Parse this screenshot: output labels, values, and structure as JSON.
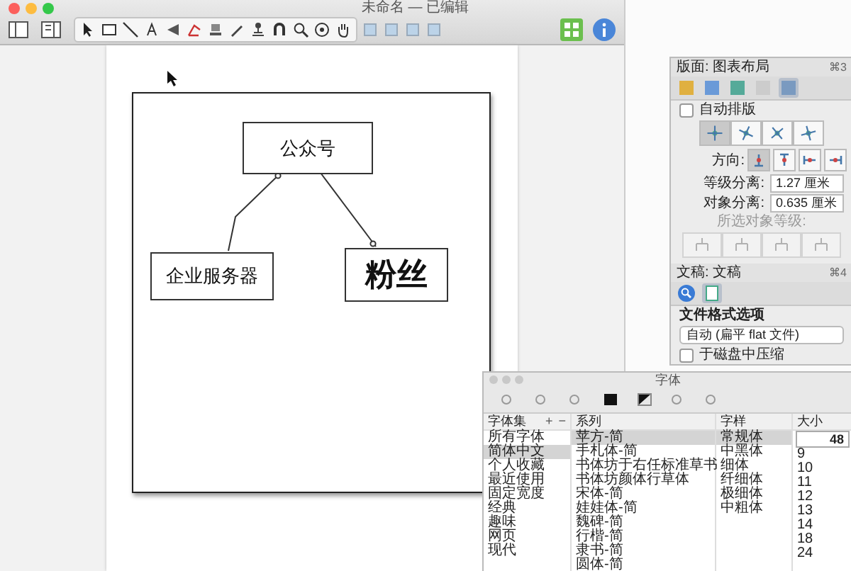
{
  "window": {
    "title": "未命名 — 已编辑"
  },
  "diagram": {
    "nodes": [
      {
        "label": "公众号",
        "kind": "normal"
      },
      {
        "label": "企业服务器",
        "kind": "normal"
      },
      {
        "label": "粉丝",
        "kind": "large"
      }
    ]
  },
  "inspector": {
    "layout": {
      "title": "版面: 图表布局",
      "shortcut": "⌘3",
      "auto_layout": {
        "label": "自动排版",
        "checked": false
      },
      "layout_types": [
        {
          "selected": true
        },
        {
          "selected": false
        },
        {
          "selected": false
        },
        {
          "selected": false
        }
      ],
      "direction_label": "方向:",
      "directions": [
        {
          "selected": true
        },
        {
          "selected": false
        },
        {
          "selected": false
        },
        {
          "selected": false
        }
      ],
      "rank_separation": {
        "label": "等级分离:",
        "value": "1.27 厘米"
      },
      "object_separation": {
        "label": "对象分离:",
        "value": "0.635 厘米"
      },
      "selected_rank_label": "所选对象等级:"
    },
    "document": {
      "title": "文稿: 文稿",
      "shortcut": "⌘4",
      "tabs": [
        {
          "selected": false
        },
        {
          "selected": true
        }
      ],
      "section_title": "文件格式选项",
      "format": "自动 (扁平 flat 文件)",
      "compress": {
        "label": "于磁盘中压缩",
        "checked": false
      }
    }
  },
  "font_panel": {
    "title": "字体",
    "headers": {
      "collections": "字体集",
      "add": "+",
      "remove": "−",
      "family": "系列",
      "typeface": "字样",
      "size": "大小"
    },
    "size_value": "48",
    "collections": [
      {
        "label": "所有字体",
        "selected": false
      },
      {
        "label": "简体中文",
        "selected": true
      },
      {
        "label": "个人收藏",
        "selected": false
      },
      {
        "label": "最近使用",
        "selected": false
      },
      {
        "label": "固定宽度",
        "selected": false
      },
      {
        "label": "经典",
        "selected": false
      },
      {
        "label": "趣味",
        "selected": false
      },
      {
        "label": "网页",
        "selected": false
      },
      {
        "label": "现代",
        "selected": false
      }
    ],
    "families": [
      {
        "label": "苹方-简",
        "selected": true
      },
      {
        "label": "手札体-简",
        "selected": false
      },
      {
        "label": "书体坊于右任标准草书",
        "selected": false
      },
      {
        "label": "书体坊颜体行草体",
        "selected": false
      },
      {
        "label": "宋体-简",
        "selected": false
      },
      {
        "label": "娃娃体-简",
        "selected": false
      },
      {
        "label": "魏碑-简",
        "selected": false
      },
      {
        "label": "行楷-简",
        "selected": false
      },
      {
        "label": "隶书-简",
        "selected": false
      },
      {
        "label": "圆体-简",
        "selected": false
      }
    ],
    "typefaces": [
      {
        "label": "常规体",
        "selected": true
      },
      {
        "label": "中黑体",
        "selected": false
      },
      {
        "label": "细体",
        "selected": false
      },
      {
        "label": "纤细体",
        "selected": false
      },
      {
        "label": "极细体",
        "selected": false
      },
      {
        "label": "中粗体",
        "selected": false
      }
    ],
    "sizes": [
      {
        "label": "9",
        "selected": false
      },
      {
        "label": "10",
        "selected": false
      },
      {
        "label": "11",
        "selected": false
      },
      {
        "label": "12",
        "selected": false
      },
      {
        "label": "13",
        "selected": false
      },
      {
        "label": "14",
        "selected": false
      },
      {
        "label": "18",
        "selected": false
      },
      {
        "label": "24",
        "selected": false
      }
    ]
  }
}
